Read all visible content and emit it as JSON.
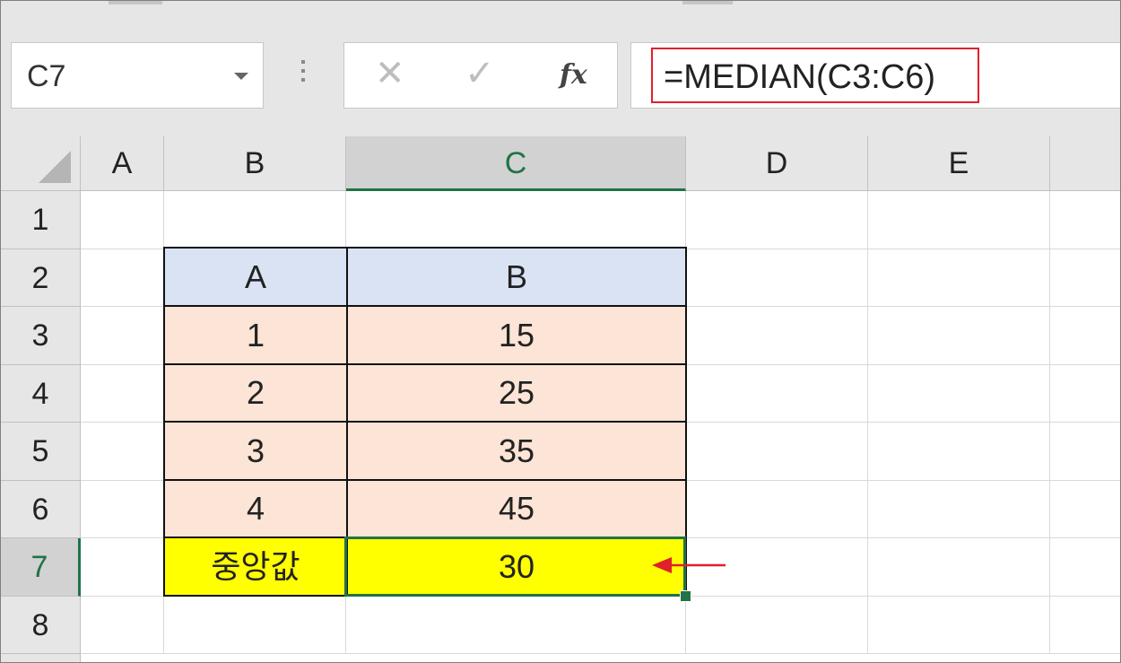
{
  "name_box": {
    "value": "C7"
  },
  "formula_bar": {
    "cancel_symbol": "✕",
    "enter_symbol": "✓",
    "fx_label": "fx",
    "formula": "=MEDIAN(C3:C6)"
  },
  "columns": [
    "A",
    "B",
    "C",
    "D",
    "E"
  ],
  "rows": [
    "1",
    "2",
    "3",
    "4",
    "5",
    "6",
    "7",
    "8"
  ],
  "selected_cell": "C7",
  "table": {
    "header_a": "A",
    "header_b": "B",
    "rows": [
      {
        "a": "1",
        "b": "15"
      },
      {
        "a": "2",
        "b": "25"
      },
      {
        "a": "3",
        "b": "35"
      },
      {
        "a": "4",
        "b": "45"
      }
    ],
    "result_label": "중앙값",
    "result_value": "30"
  },
  "colors": {
    "header_fill": "#dae3f3",
    "data_fill": "#fce4d6",
    "result_fill": "#ffff00",
    "selection": "#217346",
    "annotation": "#e0202b"
  }
}
